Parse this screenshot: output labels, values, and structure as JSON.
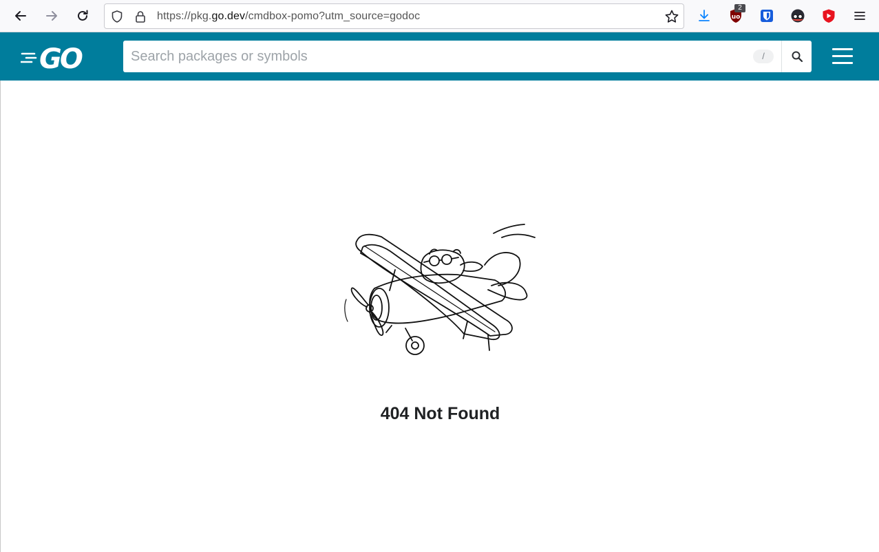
{
  "browser": {
    "url_prefix": "https://pkg.",
    "url_domain": "go.dev",
    "url_suffix": "/cmdbox-pomo?utm_source=godoc",
    "extension_badge": "2"
  },
  "site": {
    "brand_color": "#007d9c",
    "logo_text": "GO",
    "search": {
      "placeholder": "Search packages or symbols",
      "shortcut_key": "/"
    }
  },
  "main": {
    "heading": "404 Not Found",
    "image_icon": "gopher-airplane-illustration"
  },
  "icons": {
    "back": "back-arrow-icon",
    "forward": "forward-arrow-icon",
    "reload": "reload-icon",
    "shield": "tracking-shield-icon",
    "lock": "lock-icon",
    "bookmark": "bookmark-star-icon",
    "downloads": "download-icon",
    "ublock": "ublock-origin-icon",
    "bitwarden": "bitwarden-icon",
    "privacy": "spy-glasses-icon",
    "video": "play-shield-icon",
    "app_menu": "hamburger-menu-icon",
    "search": "search-icon"
  }
}
